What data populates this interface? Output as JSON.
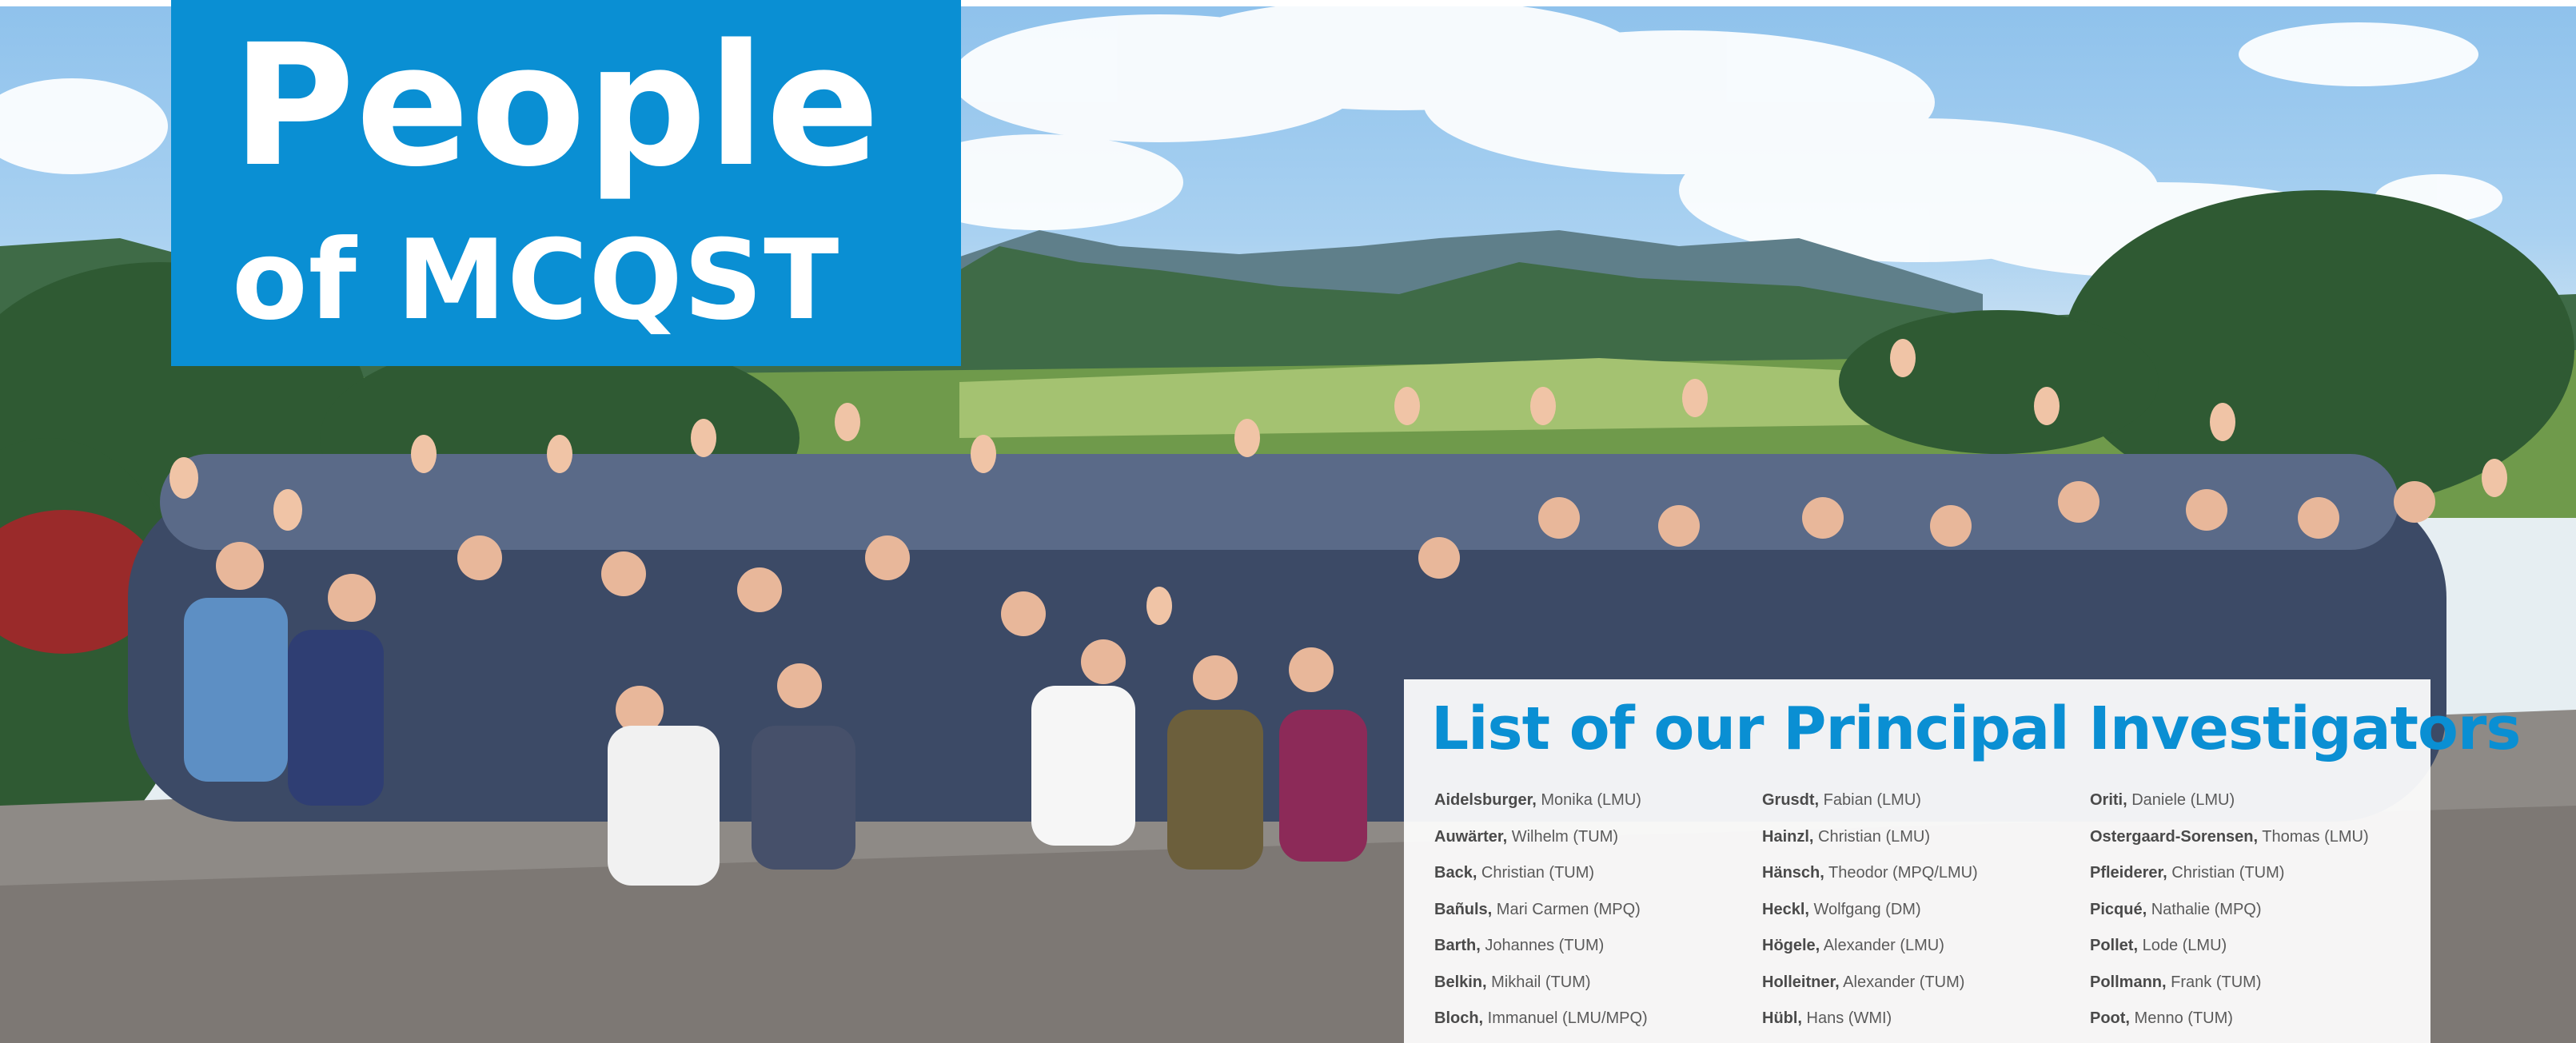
{
  "title": {
    "line1": "People",
    "line2": "of MCQST"
  },
  "pi_panel": {
    "heading": "List of our Principal Investigators",
    "columns": [
      [
        {
          "surname": "Aidelsburger,",
          "rest": " Monika (LMU)"
        },
        {
          "surname": "Auwärter,",
          "rest": " Wilhelm (TUM)"
        },
        {
          "surname": "Back,",
          "rest": " Christian (TUM)"
        },
        {
          "surname": "Bañuls,",
          "rest": " Mari Carmen (MPQ)"
        },
        {
          "surname": "Barth,",
          "rest": " Johannes (TUM)"
        },
        {
          "surname": "Belkin,",
          "rest": " Mikhail (TUM)"
        },
        {
          "surname": "Bloch,",
          "rest": " Immanuel (LMU/MPQ)"
        }
      ],
      [
        {
          "surname": "Grusdt,",
          "rest": " Fabian (LMU)"
        },
        {
          "surname": "Hainzl,",
          "rest": " Christian (LMU)"
        },
        {
          "surname": "Hänsch,",
          "rest": " Theodor (MPQ/LMU)"
        },
        {
          "surname": "Heckl,",
          "rest": " Wolfgang (DM)"
        },
        {
          "surname": "Högele,",
          "rest": " Alexander (LMU)"
        },
        {
          "surname": "Holleitner,",
          "rest": " Alexander (TUM)"
        },
        {
          "surname": "Hübl,",
          "rest": " Hans (WMI)"
        }
      ],
      [
        {
          "surname": "Oriti,",
          "rest": " Daniele (LMU)"
        },
        {
          "surname": "Ostergaard-Sorensen,",
          "rest": " Thomas (LMU)"
        },
        {
          "surname": "Pfleiderer,",
          "rest": " Christian (TUM)"
        },
        {
          "surname": "Picqué,",
          "rest": " Nathalie (MPQ)"
        },
        {
          "surname": "Pollet,",
          "rest": " Lode (LMU)"
        },
        {
          "surname": "Pollmann,",
          "rest": " Frank (TUM)"
        },
        {
          "surname": "Poot,",
          "rest": " Menno (TUM)"
        }
      ]
    ]
  },
  "colors": {
    "brand_blue": "#0a8fd3",
    "text_dark": "#4a4a4a",
    "text_light": "#5a5a5a"
  }
}
